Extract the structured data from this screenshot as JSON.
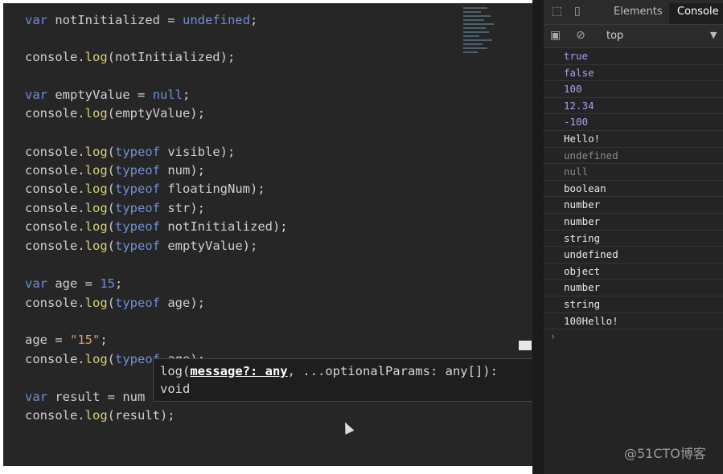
{
  "editor": {
    "lines": [
      [
        [
          "kw",
          "var"
        ],
        [
          "plain",
          " notInitialized = "
        ],
        [
          "val",
          "undefined"
        ],
        [
          "plain",
          ";"
        ]
      ],
      [
        [
          "plain",
          "console."
        ],
        [
          "fn",
          "log"
        ],
        [
          "plain",
          "(notInitialized);"
        ]
      ],
      [
        [
          "kw",
          "var"
        ],
        [
          "plain",
          " emptyValue = "
        ],
        [
          "val",
          "null"
        ],
        [
          "plain",
          ";"
        ]
      ],
      [
        [
          "plain",
          "console."
        ],
        [
          "fn",
          "log"
        ],
        [
          "plain",
          "(emptyValue);"
        ]
      ],
      [
        [
          "plain",
          "console."
        ],
        [
          "fn",
          "log"
        ],
        [
          "plain",
          "("
        ],
        [
          "kw",
          "typeof"
        ],
        [
          "plain",
          " visible);"
        ]
      ],
      [
        [
          "plain",
          "console."
        ],
        [
          "fn",
          "log"
        ],
        [
          "plain",
          "("
        ],
        [
          "kw",
          "typeof"
        ],
        [
          "plain",
          " num);"
        ]
      ],
      [
        [
          "plain",
          "console."
        ],
        [
          "fn",
          "log"
        ],
        [
          "plain",
          "("
        ],
        [
          "kw",
          "typeof"
        ],
        [
          "plain",
          " floatingNum);"
        ]
      ],
      [
        [
          "plain",
          "console."
        ],
        [
          "fn",
          "log"
        ],
        [
          "plain",
          "("
        ],
        [
          "kw",
          "typeof"
        ],
        [
          "plain",
          " str);"
        ]
      ],
      [
        [
          "plain",
          "console."
        ],
        [
          "fn",
          "log"
        ],
        [
          "plain",
          "("
        ],
        [
          "kw",
          "typeof"
        ],
        [
          "plain",
          " notInitialized);"
        ]
      ],
      [
        [
          "plain",
          "console."
        ],
        [
          "fn",
          "log"
        ],
        [
          "plain",
          "("
        ],
        [
          "kw",
          "typeof"
        ],
        [
          "plain",
          " emptyValue);"
        ]
      ],
      [
        [
          "kw",
          "var"
        ],
        [
          "plain",
          " age = "
        ],
        [
          "val",
          "15"
        ],
        [
          "plain",
          ";"
        ]
      ],
      [
        [
          "plain",
          "console."
        ],
        [
          "fn",
          "log"
        ],
        [
          "plain",
          "("
        ],
        [
          "kw",
          "typeof"
        ],
        [
          "plain",
          " age);"
        ]
      ],
      [
        [
          "plain",
          "age = "
        ],
        [
          "str",
          "\"15\""
        ],
        [
          "plain",
          ";"
        ]
      ],
      [
        [
          "plain",
          "console."
        ],
        [
          "fn",
          "log"
        ],
        [
          "plain",
          "("
        ],
        [
          "kw",
          "typeof"
        ],
        [
          "plain",
          " age);"
        ]
      ],
      [
        [
          "kw",
          "var"
        ],
        [
          "plain",
          " result = num"
        ]
      ],
      [
        [
          "plain",
          "console."
        ],
        [
          "fn",
          "log"
        ],
        [
          "plain",
          "(result);"
        ]
      ]
    ]
  },
  "tooltip": {
    "prefix": "log(",
    "param": "message?: any",
    "rest": ", ...optionalParams: any[]):",
    "line2": "void"
  },
  "devtools": {
    "tabs": [
      "Elements",
      "Console"
    ],
    "active_tab": "Console",
    "context": "top",
    "context_arrow": "▼",
    "icons": [
      "inspect-icon",
      "device-icon",
      "sidebar-toggle-icon",
      "clear-console-icon"
    ],
    "rows": [
      {
        "text": "true",
        "kind": "bool"
      },
      {
        "text": "false",
        "kind": "bool"
      },
      {
        "text": "100",
        "kind": "num"
      },
      {
        "text": "12.34",
        "kind": "num"
      },
      {
        "text": "-100",
        "kind": "num"
      },
      {
        "text": "Hello!",
        "kind": "str"
      },
      {
        "text": "undefined",
        "kind": "dim"
      },
      {
        "text": "null",
        "kind": "dim"
      },
      {
        "text": "boolean",
        "kind": "str"
      },
      {
        "text": "number",
        "kind": "str"
      },
      {
        "text": "number",
        "kind": "str"
      },
      {
        "text": "string",
        "kind": "str"
      },
      {
        "text": "undefined",
        "kind": "str"
      },
      {
        "text": "object",
        "kind": "str"
      },
      {
        "text": "number",
        "kind": "str"
      },
      {
        "text": "string",
        "kind": "str"
      },
      {
        "text": "100Hello!",
        "kind": "str"
      }
    ],
    "prompt": "›"
  },
  "watermark": "@51CTO博客",
  "colors": {
    "editor_bg": "#262626",
    "keyword": "#6f8fd6",
    "function": "#d8cf7a",
    "string": "#d3a06b",
    "console_value": "#a99ff2"
  }
}
